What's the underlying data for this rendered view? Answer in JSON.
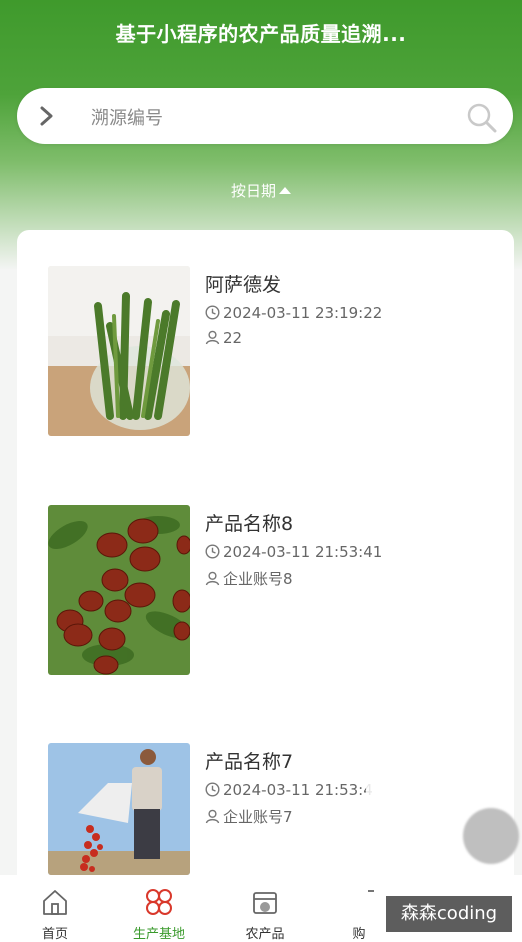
{
  "header": {
    "title": "基于小程序的农产品质量追溯..."
  },
  "search": {
    "placeholder": "溯源编号"
  },
  "sort": {
    "label": "按日期"
  },
  "items": [
    {
      "name": "阿萨德发",
      "time": "2024-03-11 23:19:22",
      "user": "22",
      "image": "okra-in-glass"
    },
    {
      "name": "产品名称8",
      "time": "2024-03-11 21:53:41",
      "user": "企业账号8",
      "image": "red-jujubes"
    },
    {
      "name": "产品名称7",
      "time": "2024-03-11 21:53:4",
      "user": "企业账号7",
      "image": "farmer-with-chilies"
    }
  ],
  "tabbar": {
    "items": [
      {
        "label": "首页",
        "icon": "home-icon"
      },
      {
        "label": "生产基地",
        "icon": "clover-icon",
        "active": true
      },
      {
        "label": "农产品",
        "icon": "box-icon"
      },
      {
        "label": "购",
        "icon": "cart-icon"
      }
    ]
  },
  "watermark": "森森coding",
  "colors": {
    "primary": "#3f9a2c",
    "active_tab": "#3a9a2c"
  }
}
